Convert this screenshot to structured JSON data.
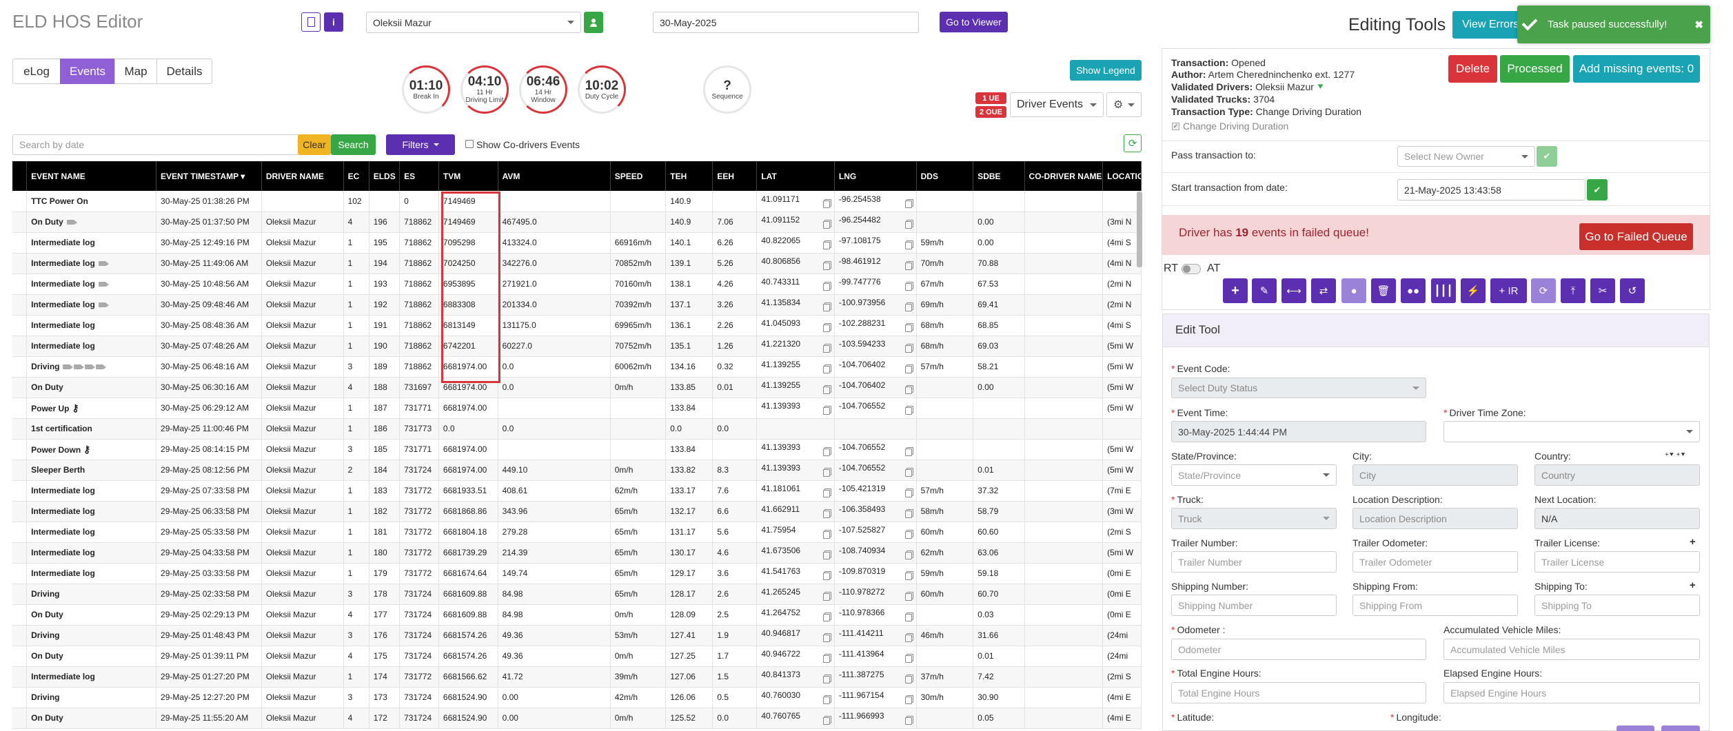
{
  "header": {
    "title": "ELD HOS Editor",
    "driver_select": "Oleksii Mazur",
    "date_value": "30-May-2025",
    "go_to_viewer": "Go to Viewer"
  },
  "tabs": [
    "eLog",
    "Events",
    "Map",
    "Details"
  ],
  "gauges": [
    {
      "value": "01:10",
      "label1": "Break In",
      "label2": ""
    },
    {
      "value": "04:10",
      "label1": "11 Hr",
      "label2": "Driving Limit"
    },
    {
      "value": "06:46",
      "label1": "14 Hr",
      "label2": "Window"
    },
    {
      "value": "10:02",
      "label1": "Duty Cycle",
      "label2": ""
    },
    {
      "value": "?",
      "label1": "Sequence",
      "label2": ""
    }
  ],
  "controls": {
    "show_legend": "Show Legend",
    "ue_badge": "1 UE",
    "oue_badge": "2 OUE",
    "driver_events": "Driver Events",
    "search_placeholder": "Search by date",
    "clear": "Clear",
    "search": "Search",
    "filters": "Filters",
    "show_co_drivers": "Show Co-drivers Events"
  },
  "table": {
    "columns": [
      "EVENT NAME",
      "EVENT TIMESTAMP",
      "DRIVER NAME",
      "EC",
      "ELDS",
      "ES",
      "TVM",
      "AVM",
      "SPEED",
      "TEH",
      "EEH",
      "LAT",
      "LNG",
      "DDS",
      "SDBE",
      "CO-DRIVER NAME",
      "LOCATION"
    ],
    "rows": [
      {
        "name": "TTC Power On",
        "cls": "ttc",
        "ts": "30-May-25 01:38:26 PM",
        "driver": "",
        "ec": "102",
        "elds": "",
        "es": "0",
        "tvm": "7149469",
        "avm": "",
        "speed": "",
        "teh": "140.9",
        "eeh": "",
        "lat": "41.091171",
        "lng": "-96.254538",
        "dds": "",
        "sdbe": "",
        "loc": ""
      },
      {
        "name": "On Duty",
        "cls": "on",
        "cam": 1,
        "ts": "30-May-25 01:37:50 PM",
        "driver": "Oleksii Mazur",
        "ec": "4",
        "elds": "196",
        "es": "718862",
        "tvm": "7149469",
        "avm": "467495.0",
        "speed": "",
        "teh": "140.9",
        "eeh": "7.06",
        "lat": "41.091152",
        "lng": "-96.254482",
        "dds": "",
        "sdbe": "0.00",
        "loc": "(3mi N"
      },
      {
        "name": "Intermediate log",
        "cls": "int",
        "ts": "30-May-25 12:49:16 PM",
        "driver": "Oleksii Mazur",
        "ec": "1",
        "elds": "195",
        "es": "718862",
        "tvm": "7095298",
        "avm": "413324.0",
        "speed": "66916m/h",
        "teh": "140.1",
        "eeh": "6.26",
        "lat": "40.822065",
        "lng": "-97.108175",
        "dds": "59m/h",
        "sdbe": "0.00",
        "loc": "(4mi S"
      },
      {
        "name": "Intermediate log",
        "cls": "int",
        "cam": 1,
        "ts": "30-May-25 11:49:06 AM",
        "driver": "Oleksii Mazur",
        "ec": "1",
        "elds": "194",
        "es": "718862",
        "tvm": "7024250",
        "avm": "342276.0",
        "speed": "70852m/h",
        "teh": "139.1",
        "eeh": "5.26",
        "lat": "40.806856",
        "lng": "-98.461912",
        "dds": "70m/h",
        "sdbe": "70.88",
        "loc": "(4mi N"
      },
      {
        "name": "Intermediate log",
        "cls": "int",
        "cam": 1,
        "ts": "30-May-25 10:48:56 AM",
        "driver": "Oleksii Mazur",
        "ec": "1",
        "elds": "193",
        "es": "718862",
        "tvm": "6953895",
        "avm": "271921.0",
        "speed": "70160m/h",
        "teh": "138.1",
        "eeh": "4.26",
        "lat": "40.743311",
        "lng": "-99.747776",
        "dds": "67m/h",
        "sdbe": "67.53",
        "loc": "(2mi N"
      },
      {
        "name": "Intermediate log",
        "cls": "int",
        "cam": 1,
        "ts": "30-May-25 09:48:46 AM",
        "driver": "Oleksii Mazur",
        "ec": "1",
        "elds": "192",
        "es": "718862",
        "tvm": "6883308",
        "avm": "201334.0",
        "speed": "70392m/h",
        "teh": "137.1",
        "eeh": "3.26",
        "lat": "41.135834",
        "lng": "-100.973956",
        "dds": "69m/h",
        "sdbe": "69.41",
        "loc": "(2mi N"
      },
      {
        "name": "Intermediate log",
        "cls": "int",
        "ts": "30-May-25 08:48:36 AM",
        "driver": "Oleksii Mazur",
        "ec": "1",
        "elds": "191",
        "es": "718862",
        "tvm": "6813149",
        "avm": "131175.0",
        "speed": "69965m/h",
        "teh": "136.1",
        "eeh": "2.26",
        "lat": "41.045093",
        "lng": "-102.288231",
        "dds": "68m/h",
        "sdbe": "68.85",
        "loc": "(4mi S"
      },
      {
        "name": "Intermediate log",
        "cls": "int",
        "ts": "30-May-25 07:48:26 AM",
        "driver": "Oleksii Mazur",
        "ec": "1",
        "elds": "190",
        "es": "718862",
        "tvm": "6742201",
        "avm": "60227.0",
        "speed": "70752m/h",
        "teh": "135.1",
        "eeh": "1.26",
        "lat": "41.221320",
        "lng": "-103.594233",
        "dds": "68m/h",
        "sdbe": "69.03",
        "loc": "(5mi W"
      },
      {
        "name": "Driving",
        "cls": "drv",
        "cam": 4,
        "ts": "30-May-25 06:48:16 AM",
        "driver": "Oleksii Mazur",
        "ec": "3",
        "elds": "189",
        "es": "718862",
        "tvm": "6681974.00",
        "avm": "0.0",
        "speed": "60062m/h",
        "teh": "134.16",
        "eeh": "0.32",
        "lat": "41.139255",
        "lng": "-104.706402",
        "dds": "57m/h",
        "sdbe": "58.21",
        "loc": "(5mi W"
      },
      {
        "name": "On Duty",
        "cls": "on",
        "ts": "30-May-25 06:30:16 AM",
        "driver": "Oleksii Mazur",
        "ec": "4",
        "elds": "188",
        "es": "731697",
        "tvm": "6681974.00",
        "avm": "0.0",
        "speed": "0m/h",
        "teh": "133.85",
        "eeh": "0.01",
        "lat": "41.139255",
        "lng": "-104.706402",
        "dds": "",
        "sdbe": "0.00",
        "loc": "(5mi W"
      },
      {
        "name": "Power Up",
        "cls": "pu",
        "key": 1,
        "ts": "30-May-25 06:29:12 AM",
        "driver": "Oleksii Mazur",
        "ec": "1",
        "elds": "187",
        "es": "731771",
        "tvm": "6681974.00",
        "avm": "",
        "speed": "",
        "teh": "133.84",
        "eeh": "",
        "lat": "41.139393",
        "lng": "-104.706552",
        "dds": "",
        "sdbe": "",
        "loc": "(5mi W"
      },
      {
        "name": "1st certification",
        "cls": "cert",
        "ts": "29-May-25 11:00:46 PM",
        "driver": "Oleksii Mazur",
        "ec": "1",
        "elds": "186",
        "es": "731773",
        "tvm": "0.0",
        "avm": "0.0",
        "speed": "",
        "teh": "0.0",
        "eeh": "0.0",
        "lat": "",
        "lng": "",
        "dds": "",
        "sdbe": "",
        "loc": ""
      },
      {
        "name": "Power Down",
        "cls": "pd",
        "key": 1,
        "ts": "29-May-25 08:14:15 PM",
        "driver": "Oleksii Mazur",
        "ec": "3",
        "elds": "185",
        "es": "731771",
        "tvm": "6681974.00",
        "avm": "",
        "speed": "",
        "teh": "133.84",
        "eeh": "",
        "lat": "41.139393",
        "lng": "-104.706552",
        "dds": "",
        "sdbe": "",
        "loc": "(5mi W"
      },
      {
        "name": "Sleeper Berth",
        "cls": "sb",
        "ts": "29-May-25 08:12:56 PM",
        "driver": "Oleksii Mazur",
        "ec": "2",
        "elds": "184",
        "es": "731724",
        "tvm": "6681974.00",
        "avm": "449.10",
        "speed": "0m/h",
        "teh": "133.82",
        "eeh": "8.3",
        "lat": "41.139393",
        "lng": "-104.706552",
        "dds": "",
        "sdbe": "0.01",
        "loc": "(5mi W"
      },
      {
        "name": "Intermediate log",
        "cls": "int",
        "ts": "29-May-25 07:33:58 PM",
        "driver": "Oleksii Mazur",
        "ec": "1",
        "elds": "183",
        "es": "731772",
        "tvm": "6681933.51",
        "avm": "408.61",
        "speed": "62m/h",
        "teh": "133.17",
        "eeh": "7.6",
        "lat": "41.181061",
        "lng": "-105.421319",
        "dds": "57m/h",
        "sdbe": "37.32",
        "loc": "(7mi E"
      },
      {
        "name": "Intermediate log",
        "cls": "int",
        "ts": "29-May-25 06:33:58 PM",
        "driver": "Oleksii Mazur",
        "ec": "1",
        "elds": "182",
        "es": "731772",
        "tvm": "6681868.86",
        "avm": "343.96",
        "speed": "65m/h",
        "teh": "132.17",
        "eeh": "6.6",
        "lat": "41.662911",
        "lng": "-106.358493",
        "dds": "58m/h",
        "sdbe": "58.79",
        "loc": "(3mi W"
      },
      {
        "name": "Intermediate log",
        "cls": "int",
        "ts": "29-May-25 05:33:58 PM",
        "driver": "Oleksii Mazur",
        "ec": "1",
        "elds": "181",
        "es": "731772",
        "tvm": "6681804.18",
        "avm": "279.28",
        "speed": "65m/h",
        "teh": "131.17",
        "eeh": "5.6",
        "lat": "41.75954",
        "lng": "-107.525827",
        "dds": "60m/h",
        "sdbe": "60.60",
        "loc": "(2mi S"
      },
      {
        "name": "Intermediate log",
        "cls": "int",
        "ts": "29-May-25 04:33:58 PM",
        "driver": "Oleksii Mazur",
        "ec": "1",
        "elds": "180",
        "es": "731772",
        "tvm": "6681739.29",
        "avm": "214.39",
        "speed": "65m/h",
        "teh": "130.17",
        "eeh": "4.6",
        "lat": "41.673506",
        "lng": "-108.740934",
        "dds": "62m/h",
        "sdbe": "63.06",
        "loc": "(5mi W"
      },
      {
        "name": "Intermediate log",
        "cls": "int",
        "ts": "29-May-25 03:33:58 PM",
        "driver": "Oleksii Mazur",
        "ec": "1",
        "elds": "179",
        "es": "731772",
        "tvm": "6681674.64",
        "avm": "149.74",
        "speed": "65m/h",
        "teh": "129.17",
        "eeh": "3.6",
        "lat": "41.541763",
        "lng": "-109.870319",
        "dds": "59m/h",
        "sdbe": "59.18",
        "loc": "(0mi E"
      },
      {
        "name": "Driving",
        "cls": "drv",
        "ts": "29-May-25 02:33:58 PM",
        "driver": "Oleksii Mazur",
        "ec": "3",
        "elds": "178",
        "es": "731724",
        "tvm": "6681609.88",
        "avm": "84.98",
        "speed": "65m/h",
        "teh": "128.17",
        "eeh": "2.6",
        "lat": "41.265245",
        "lng": "-110.978272",
        "dds": "60m/h",
        "sdbe": "60.70",
        "loc": "(0mi E"
      },
      {
        "name": "On Duty",
        "cls": "on",
        "ts": "29-May-25 02:29:13 PM",
        "driver": "Oleksii Mazur",
        "ec": "4",
        "elds": "177",
        "es": "731724",
        "tvm": "6681609.88",
        "avm": "84.98",
        "speed": "0m/h",
        "teh": "128.09",
        "eeh": "2.5",
        "lat": "41.264752",
        "lng": "-110.978366",
        "dds": "",
        "sdbe": "0.03",
        "loc": "(0mi E"
      },
      {
        "name": "Driving",
        "cls": "drv",
        "ts": "29-May-25 01:48:43 PM",
        "driver": "Oleksii Mazur",
        "ec": "3",
        "elds": "176",
        "es": "731724",
        "tvm": "6681574.26",
        "avm": "49.36",
        "speed": "53m/h",
        "teh": "127.41",
        "eeh": "1.9",
        "lat": "40.946817",
        "lng": "-111.414211",
        "dds": "46m/h",
        "sdbe": "31.66",
        "loc": "(24mi"
      },
      {
        "name": "On Duty",
        "cls": "on",
        "ts": "29-May-25 01:39:11 PM",
        "driver": "Oleksii Mazur",
        "ec": "4",
        "elds": "175",
        "es": "731724",
        "tvm": "6681574.26",
        "avm": "49.36",
        "speed": "0m/h",
        "teh": "127.25",
        "eeh": "1.7",
        "lat": "40.946722",
        "lng": "-111.413964",
        "dds": "",
        "sdbe": "0.01",
        "loc": "(24mi"
      },
      {
        "name": "Intermediate log",
        "cls": "int",
        "ts": "29-May-25 01:27:20 PM",
        "driver": "Oleksii Mazur",
        "ec": "1",
        "elds": "174",
        "es": "731772",
        "tvm": "6681566.62",
        "avm": "41.72",
        "speed": "39m/h",
        "teh": "127.06",
        "eeh": "1.5",
        "lat": "40.841373",
        "lng": "-111.387275",
        "dds": "37m/h",
        "sdbe": "7.42",
        "loc": "(2mi S"
      },
      {
        "name": "Driving",
        "cls": "drv",
        "ts": "29-May-25 12:27:20 PM",
        "driver": "Oleksii Mazur",
        "ec": "3",
        "elds": "173",
        "es": "731724",
        "tvm": "6681524.90",
        "avm": "0.00",
        "speed": "42m/h",
        "teh": "126.06",
        "eeh": "0.5",
        "lat": "40.760030",
        "lng": "-111.967154",
        "dds": "30m/h",
        "sdbe": "30.90",
        "loc": "(4mi E"
      },
      {
        "name": "On Duty",
        "cls": "on",
        "ts": "29-May-25 11:55:20 AM",
        "driver": "Oleksii Mazur",
        "ec": "4",
        "elds": "172",
        "es": "731724",
        "tvm": "6681524.90",
        "avm": "0.00",
        "speed": "0m/h",
        "teh": "125.52",
        "eeh": "0.0",
        "lat": "40.760765",
        "lng": "-111.966993",
        "dds": "",
        "sdbe": "0.05",
        "loc": "(4mi E"
      }
    ]
  },
  "right": {
    "editing_tools": "Editing Tools",
    "view_errors": "View Errors",
    "toast": "Task paused successfully!",
    "transaction": {
      "label": "Transaction:",
      "value": "Opened"
    },
    "author": {
      "label": "Author:",
      "value": "Artem Cheredninchenko ext. 1277"
    },
    "validated_drivers": {
      "label": "Validated Drivers:",
      "value": "Oleksii Mazur"
    },
    "validated_trucks": {
      "label": "Validated Trucks:",
      "value": "3704"
    },
    "transaction_type": {
      "label": "Transaction Type:",
      "value": "Change Driving Duration"
    },
    "checkbox_label": "Change Driving Duration",
    "delete": "Delete",
    "processed": "Processed",
    "add_missing": "Add missing events: 0",
    "pass_transaction_label": "Pass transaction to:",
    "pass_placeholder": "Select New Owner",
    "start_from_label": "Start transaction from date:",
    "start_from_value": "21-May-2025 13:43:58",
    "failed_prefix": "Driver has",
    "failed_count": "19",
    "failed_suffix": "events in failed queue!",
    "go_failed": "Go to Failed Queue",
    "rt": "RT",
    "at": "AT",
    "edit_tool_title": "Edit Tool",
    "ir_label": "+ IR"
  },
  "form": {
    "event_code_label": "Event Code:",
    "event_code_placeholder": "Select Duty Status",
    "event_time_label": "Event Time:",
    "event_time_value": "30-May-2025 1:44:44 PM",
    "driver_tz_label": "Driver Time Zone:",
    "state_label": "State/Province:",
    "state_placeholder": "State/Province",
    "city_label": "City:",
    "city_placeholder": "City",
    "country_label": "Country:",
    "country_placeholder": "Country",
    "truck_label": "Truck:",
    "truck_placeholder": "Truck",
    "loc_desc_label": "Location Description:",
    "loc_desc_placeholder": "Location Description",
    "next_loc_label": "Next Location:",
    "next_loc_value": "N/A",
    "trailer_num_label": "Trailer Number:",
    "trailer_num_placeholder": "Trailer Number",
    "trailer_odo_label": "Trailer Odometer:",
    "trailer_odo_placeholder": "Trailer Odometer",
    "trailer_lic_label": "Trailer License:",
    "trailer_lic_placeholder": "Trailer License",
    "ship_num_label": "Shipping Number:",
    "ship_num_placeholder": "Shipping Number",
    "ship_from_label": "Shipping From:",
    "ship_from_placeholder": "Shipping From",
    "ship_to_label": "Shipping To:",
    "ship_to_placeholder": "Shipping To",
    "odometer_label": "Odometer :",
    "odometer_placeholder": "Odometer",
    "acc_miles_label": "Accumulated Vehicle Miles:",
    "acc_miles_placeholder": "Accumulated Vehicle Miles",
    "engine_hours_label": "Total Engine Hours:",
    "engine_hours_placeholder": "Total Engine Hours",
    "elapsed_label": "Elapsed Engine Hours:",
    "elapsed_placeholder": "Elapsed Engine Hours",
    "latitude_label": "Latitude:",
    "longitude_label": "Longitude:"
  }
}
